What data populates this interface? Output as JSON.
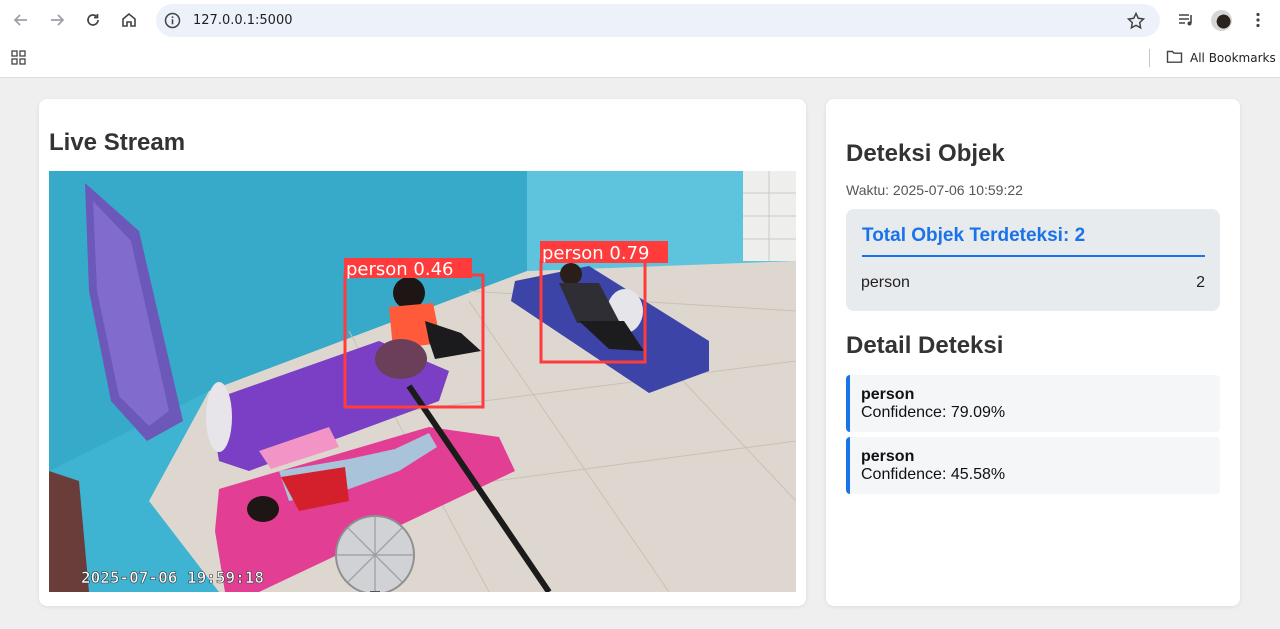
{
  "browser": {
    "url": "127.0.0.1:5000",
    "bookmarks_label": "All Bookmarks",
    "icons": [
      "back-arrow-icon",
      "forward-arrow-icon",
      "reload-icon",
      "home-icon",
      "info-icon",
      "star-icon",
      "media-controls-icon",
      "avatar",
      "kebab-menu-icon",
      "apps-grid-icon",
      "folder-icon"
    ]
  },
  "live": {
    "title": "Live Stream",
    "stream": {
      "timestamp": "2025-07-06 19:59:18",
      "boxes": [
        {
          "label": "person 0.46"
        },
        {
          "label": "person 0.79"
        }
      ]
    }
  },
  "panel": {
    "title": "Deteksi Objek",
    "waktu": "Waktu: 2025-07-06 10:59:22",
    "summary": {
      "title": "Total Objek Terdeteksi: 2",
      "rows": [
        {
          "label": "person",
          "count": "2"
        }
      ]
    },
    "detail_title": "Detail Deteksi",
    "details": [
      {
        "name": "person",
        "confidence": "Confidence: 79.09%"
      },
      {
        "name": "person",
        "confidence": "Confidence: 45.58%"
      }
    ]
  },
  "colors": {
    "accent": "#1a73e8",
    "box": "#ff3b3b",
    "wall": "#47b8d6"
  }
}
